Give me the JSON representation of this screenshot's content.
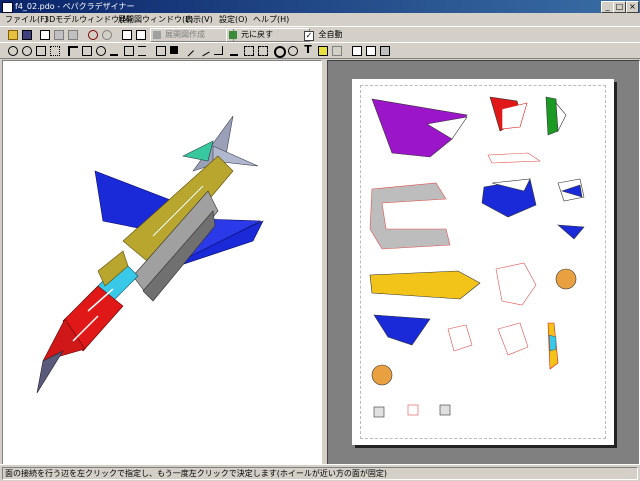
{
  "window": {
    "title": "f4_02.pdo - ペパクラデザイナー",
    "minimize_glyph": "_",
    "maximize_glyph": "□",
    "close_glyph": "×"
  },
  "menu": {
    "file": "ファイル(F)",
    "model3d": "3Dモデルウィンドウ(M)",
    "unfold": "展開図ウィンドウ(E)",
    "view": "表示(V)",
    "settings": "設定(O)",
    "help": "ヘルプ(H)"
  },
  "toolbar": {
    "unfold_label": "展開図作成",
    "undo_label": "元に戻す",
    "auto_label": "全自動",
    "auto_checked": "✓",
    "text_tool_glyph": "T",
    "icons": [
      "open-icon",
      "save-icon",
      "print-preview-icon",
      "texture-icon",
      "settings-icon",
      "zoom-icon",
      "rotate-icon",
      "pan-icon",
      "view-icon",
      "fit-icon",
      "unfold-icon",
      "page-icon",
      "join-icon",
      "split-icon",
      "flap-icon",
      "move-icon",
      "rotate-part-icon",
      "scale-icon",
      "draw-icon",
      "line-icon",
      "select-icon",
      "edit-icon",
      "text-icon",
      "image-icon",
      "layout-icon",
      "copy-icon",
      "print-icon"
    ]
  },
  "status": {
    "message": "面の接続を行う辺を左クリックで指定し、もう一度左クリックで決定します(ホイールが近い方の面が固定)"
  },
  "colors": {
    "accent": "#0a246a",
    "purple": "#9b16c8",
    "red": "#e01818",
    "green": "#1a9a22",
    "blue": "#1a2ad8",
    "yellow": "#f2c41a",
    "olive": "#b9a62e",
    "grey": "#a0a0a0",
    "cyan": "#38c8e8"
  }
}
